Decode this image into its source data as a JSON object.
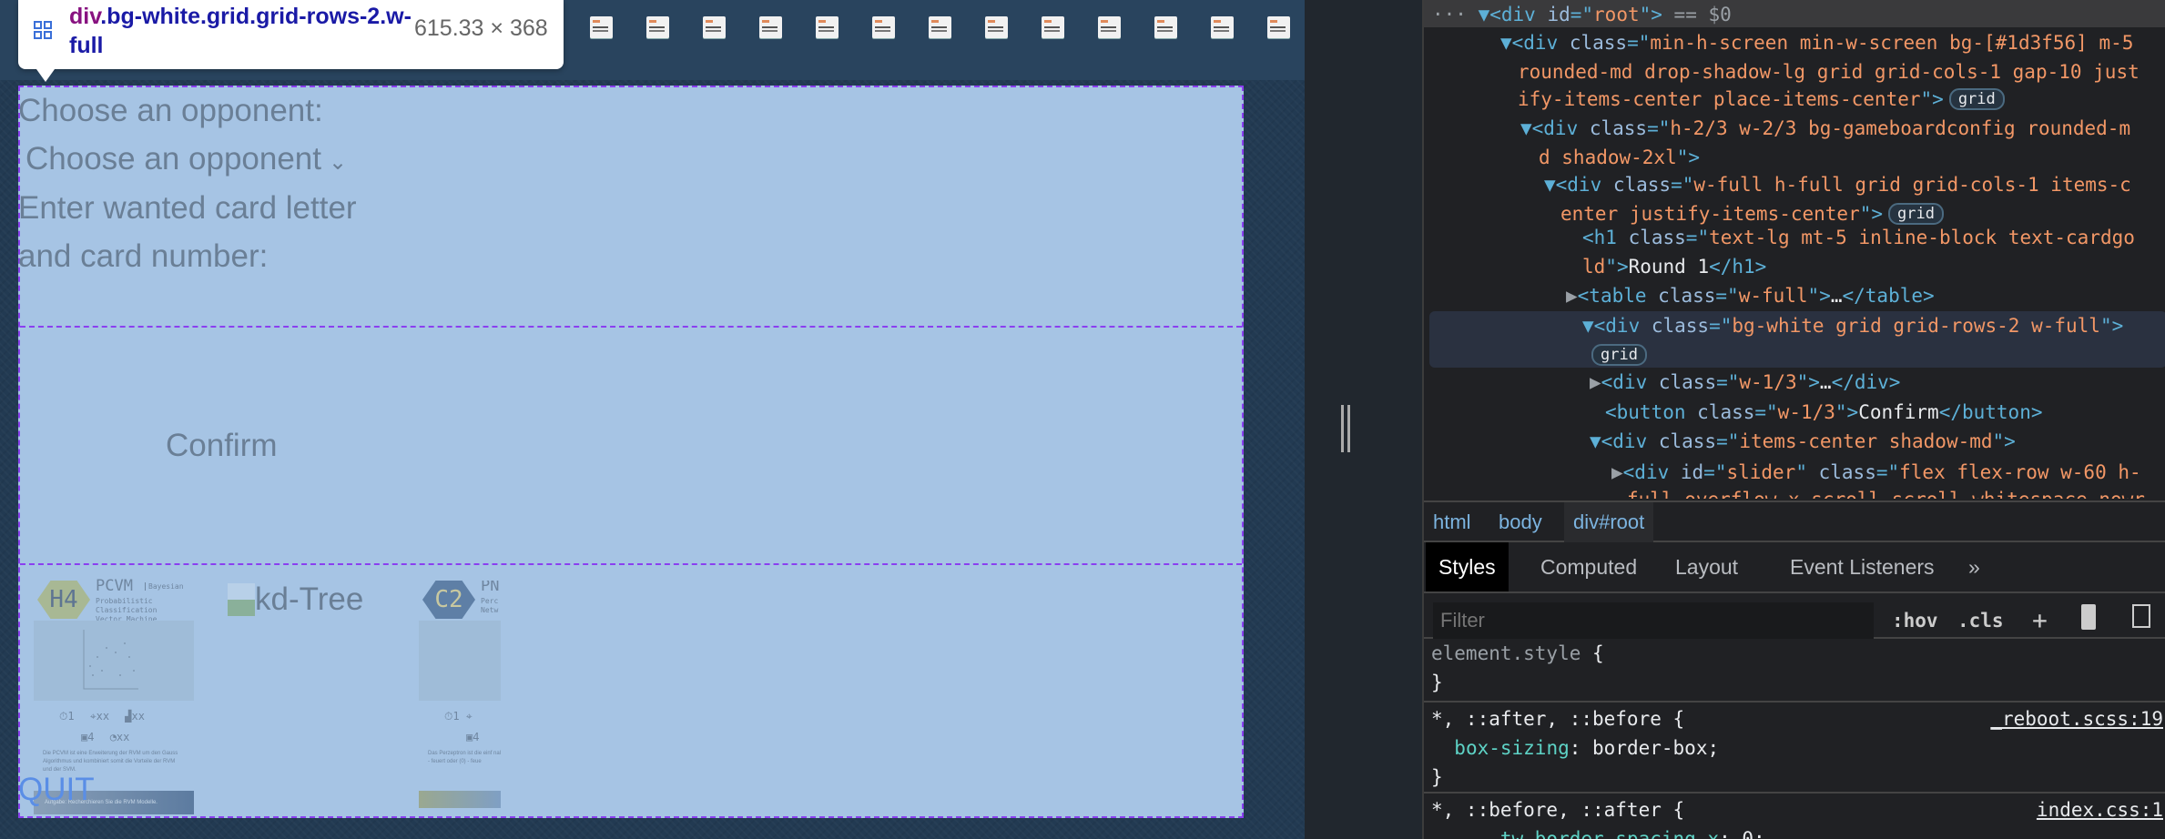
{
  "tooltip": {
    "tag": "div",
    "selector": ".bg-white.grid.grid-rows-2.w-full",
    "size": "615.33 × 368",
    "icon": "grid-icon"
  },
  "page": {
    "thumbnail_count": 13,
    "opponent_label": "Choose an opponent:",
    "opponent_select": "Choose an opponent",
    "card_label_1": "Enter wanted card letter",
    "card_label_2": "and card number:",
    "confirm": "Confirm",
    "quit": "QUIT",
    "cards": [
      {
        "code": "H4",
        "name": "PCVM",
        "category": "Bayesian",
        "subtitle": "Probabilistic Classification Vector Machine",
        "stats": [
          "1",
          "xx",
          "xx",
          "4",
          "xx"
        ],
        "description": "Die PCVM ist eine Erweiterung der RVM um den Gauss Algorithmus und kombiniert somit die Vorteile der RVM und der SVM.",
        "task": "Aufgabe: Recherchieren Sie die RVM Modelle."
      },
      {
        "broken_image_alt": "kd-Tree"
      },
      {
        "code": "C2",
        "name": "PN",
        "subtitle": "Perc Netw",
        "stats": [
          "1",
          "4"
        ],
        "description": "Das Perzeptron ist die einf nalen Netzes. Es besteht a Eingängen, einem Neuron Ausgabe. Die Zustände de (1) - feuert oder (0) - feue"
      }
    ],
    "colors": {
      "overlay": "#a6c4e4",
      "outline": "#8a3ff0",
      "page_bg": "#1d3f56"
    }
  },
  "devtools": {
    "lines": [
      [
        [
          "gr",
          "··· "
        ],
        [
          "tg",
          "▼<div "
        ],
        [
          "an",
          "id"
        ],
        [
          "tg",
          "=\""
        ],
        [
          "av",
          "root"
        ],
        [
          "tg",
          "\">"
        ],
        [
          "gr",
          " == $0"
        ]
      ],
      [
        [
          "tg",
          "▼<div "
        ],
        [
          "an",
          "class"
        ],
        [
          "tg",
          "=\""
        ],
        [
          "av",
          "min-h-screen min-w-screen bg-[#1d3f56] m-5"
        ]
      ],
      [
        [
          "av",
          "rounded-md drop-shadow-lg grid grid-cols-1 gap-10 just"
        ]
      ],
      [
        [
          "av",
          "ify-items-center place-items-center"
        ],
        [
          "tg",
          "\">"
        ],
        [
          "badge",
          "grid"
        ]
      ],
      [
        [
          "tg",
          "▼<div "
        ],
        [
          "an",
          "class"
        ],
        [
          "tg",
          "=\""
        ],
        [
          "av",
          "h-2/3 w-2/3 bg-gameboardconfig rounded-m"
        ]
      ],
      [
        [
          "av",
          "d shadow-2xl"
        ],
        [
          "tg",
          "\">"
        ]
      ],
      [
        [
          "tg",
          "▼<div "
        ],
        [
          "an",
          "class"
        ],
        [
          "tg",
          "=\""
        ],
        [
          "av",
          "w-full h-full grid grid-cols-1 items-c"
        ]
      ],
      [
        [
          "av",
          "enter justify-items-center"
        ],
        [
          "tg",
          "\">"
        ],
        [
          "badge",
          "grid"
        ]
      ],
      [
        [
          "tg",
          "<h1 "
        ],
        [
          "an",
          "class"
        ],
        [
          "tg",
          "=\""
        ],
        [
          "av",
          "text-lg mt-5 inline-block text-cardgo"
        ]
      ],
      [
        [
          "av",
          "ld"
        ],
        [
          "tg",
          "\">"
        ],
        [
          "tx",
          "Round 1"
        ],
        [
          "tg",
          "</h1>"
        ]
      ],
      [
        [
          "gr",
          "▶"
        ],
        [
          "tg",
          "<table "
        ],
        [
          "an",
          "class"
        ],
        [
          "tg",
          "=\""
        ],
        [
          "av",
          "w-full"
        ],
        [
          "tg",
          "\">"
        ],
        [
          "tx",
          "…"
        ],
        [
          "tg",
          "</table>"
        ]
      ],
      [
        [
          "tg",
          "▼<div "
        ],
        [
          "an",
          "class"
        ],
        [
          "tg",
          "=\""
        ],
        [
          "av",
          "bg-white grid grid-rows-2 w-full"
        ],
        [
          "tg",
          "\">"
        ]
      ],
      [
        [
          "badge",
          "grid"
        ]
      ],
      [
        [
          "gr",
          "▶"
        ],
        [
          "tg",
          "<div "
        ],
        [
          "an",
          "class"
        ],
        [
          "tg",
          "=\""
        ],
        [
          "av",
          "w-1/3"
        ],
        [
          "tg",
          "\">"
        ],
        [
          "tx",
          "…"
        ],
        [
          "tg",
          "</div>"
        ]
      ],
      [
        [
          "tg",
          "<button "
        ],
        [
          "an",
          "class"
        ],
        [
          "tg",
          "=\""
        ],
        [
          "av",
          "w-1/3"
        ],
        [
          "tg",
          "\">"
        ],
        [
          "tx",
          "Confirm"
        ],
        [
          "tg",
          "</button>"
        ]
      ],
      [
        [
          "tg",
          "▼<div "
        ],
        [
          "an",
          "class"
        ],
        [
          "tg",
          "=\""
        ],
        [
          "av",
          "items-center shadow-md"
        ],
        [
          "tg",
          "\">"
        ]
      ],
      [
        [
          "gr",
          "▶"
        ],
        [
          "tg",
          "<div "
        ],
        [
          "an",
          "id"
        ],
        [
          "tg",
          "=\""
        ],
        [
          "av",
          "slider"
        ],
        [
          "tg",
          "\" "
        ],
        [
          "an",
          "class"
        ],
        [
          "tg",
          "=\""
        ],
        [
          "av",
          "flex flex-row w-60 h-"
        ]
      ],
      [
        [
          "av",
          "full overflow-x-scroll scroll whitespace-nowr"
        ]
      ]
    ],
    "breadcrumbs": [
      "html",
      "body",
      "div#root"
    ],
    "tabs": [
      "Styles",
      "Computed",
      "Layout",
      "Event Listeners",
      "»"
    ],
    "active_tab": "Styles",
    "filter_placeholder": "Filter",
    "tools": [
      ":hov",
      ".cls",
      "+"
    ],
    "rules": [
      {
        "selector": "element.style",
        "open": " {",
        "close": "}"
      },
      {
        "selector": "*, ::after, ::before",
        "open": " {",
        "source": "_reboot.scss:19",
        "prop": "box-sizing",
        "value": "border-box;",
        "close": "}"
      },
      {
        "selector": "*, ::before, ::after",
        "open": " {",
        "source": "index.css:1",
        "prop": "--tw-border-spacing-x",
        "value": "0;"
      }
    ]
  }
}
